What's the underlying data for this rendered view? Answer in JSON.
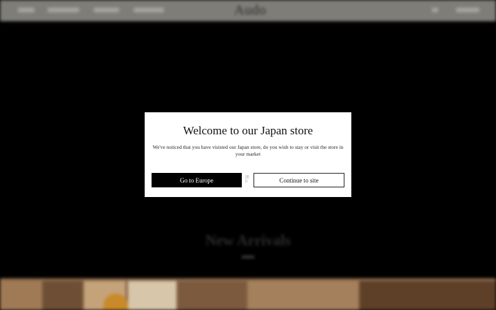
{
  "header": {
    "brand": "Audo"
  },
  "modal": {
    "title": "Welcome to our Japan store",
    "message": "We've noticed that you have visisted our Japan store, do you wish to stay or visit the store in your market",
    "primary_label": "Go to Europe",
    "secondary_label": "Continue to site"
  },
  "hero": {
    "title": "New Arrivals"
  },
  "colors": {
    "topbar": "#7f7d78",
    "modal_bg": "#ffffff",
    "primary_button": "#000000",
    "product_strip": "#8e6c4d"
  }
}
